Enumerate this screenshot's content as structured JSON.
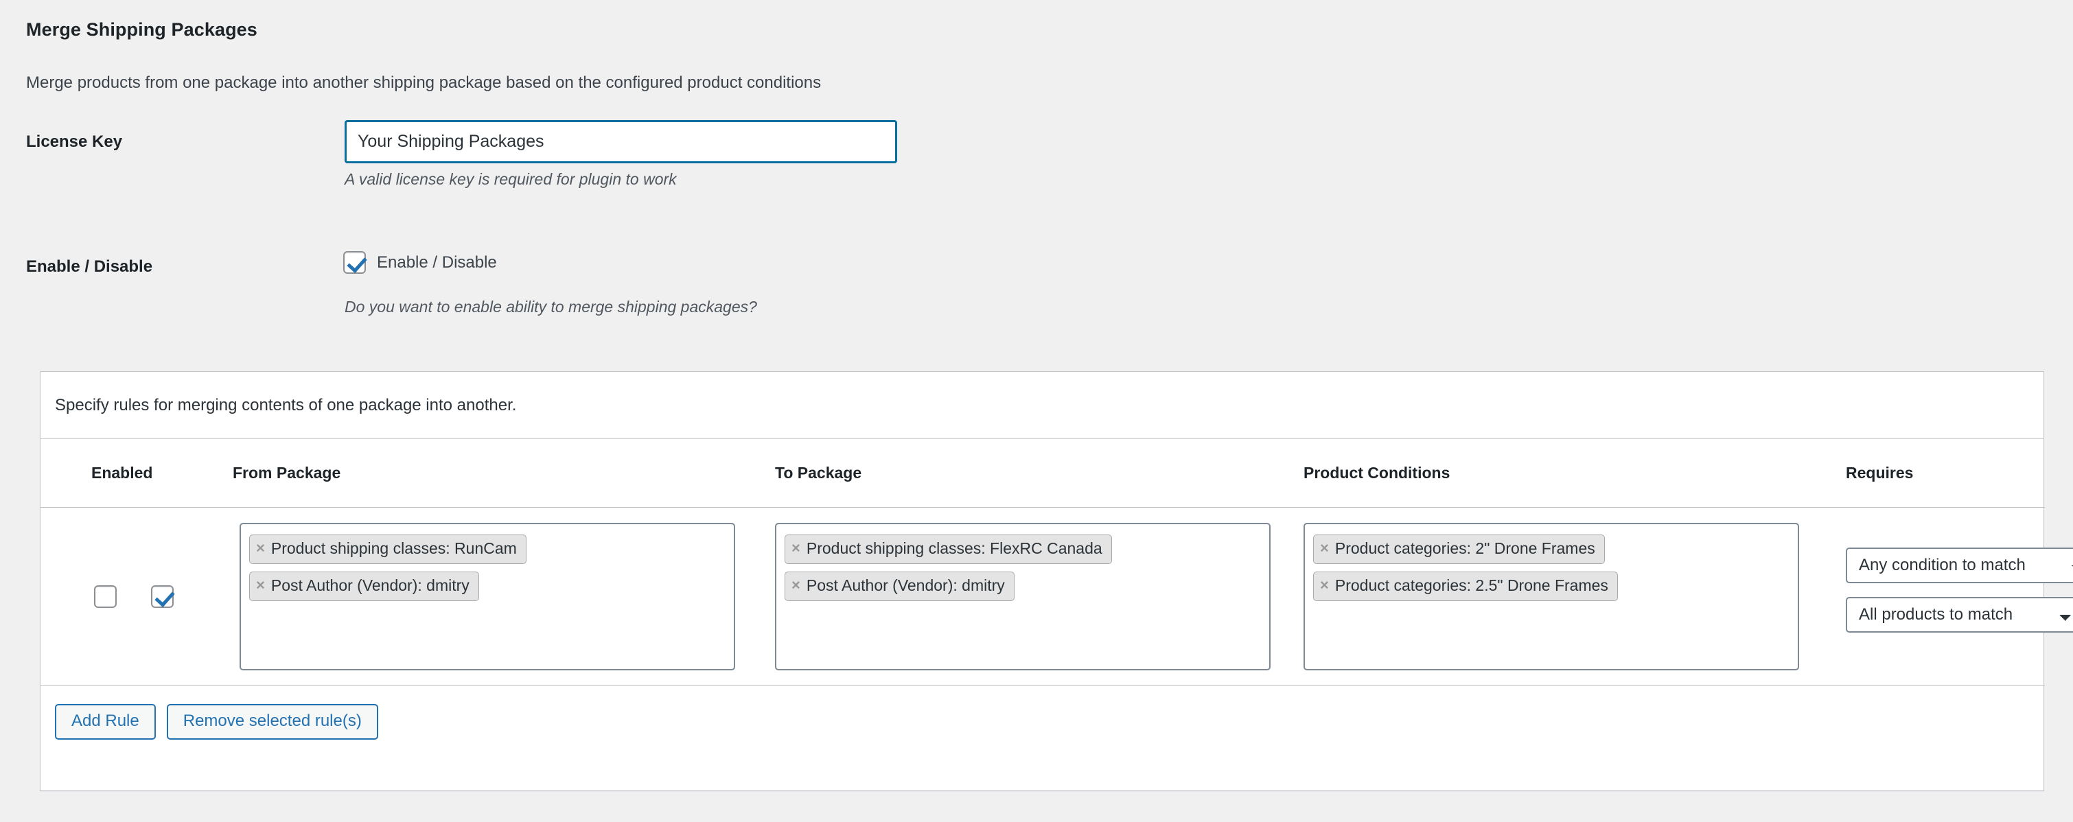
{
  "page": {
    "title": "Merge Shipping Packages",
    "description": "Merge products from one package into another shipping package based on the configured product conditions"
  },
  "settings": {
    "license": {
      "label": "License Key",
      "value": "Your Shipping Packages",
      "placeholder": "Your Shipping Packages",
      "help": "A valid license key is required for plugin to work"
    },
    "enable": {
      "label": "Enable / Disable",
      "checkbox_label": "Enable / Disable",
      "checked": true,
      "help": "Do you want to enable ability to merge shipping packages?"
    }
  },
  "rules_panel": {
    "intro": "Specify rules for merging contents of one package into another.",
    "columns": {
      "select": "",
      "enabled": "Enabled",
      "from_package": "From Package",
      "to_package": "To Package",
      "product_conditions": "Product Conditions",
      "requires": "Requires"
    },
    "rows": [
      {
        "selected": false,
        "enabled": true,
        "from_package": [
          {
            "remove": "×",
            "label": "Product shipping classes: RunCam"
          },
          {
            "remove": "×",
            "label": "Post Author (Vendor): dmitry"
          }
        ],
        "to_package": [
          {
            "remove": "×",
            "label": "Product shipping classes: FlexRC Canada"
          },
          {
            "remove": "×",
            "label": "Post Author (Vendor): dmitry"
          }
        ],
        "product_conditions": [
          {
            "remove": "×",
            "label": "Product categories: 2\" Drone Frames"
          },
          {
            "remove": "×",
            "label": "Product categories: 2.5\" Drone Frames"
          }
        ],
        "requires": {
          "condition_match": "Any condition to match",
          "products_match": "All products to match"
        }
      }
    ],
    "actions": {
      "add_rule": "Add Rule",
      "remove_rules": "Remove selected rule(s)"
    }
  },
  "colors": {
    "page_bg": "#f0f0f1",
    "panel_bg": "#ffffff",
    "border": "#c3c4c7",
    "accent_blue": "#2271b1",
    "focus_blue": "#0a6e9e",
    "text": "#3c434a",
    "heading": "#1d2327",
    "tag_bg": "#e4e4e4",
    "control_border": "#7e8993"
  }
}
